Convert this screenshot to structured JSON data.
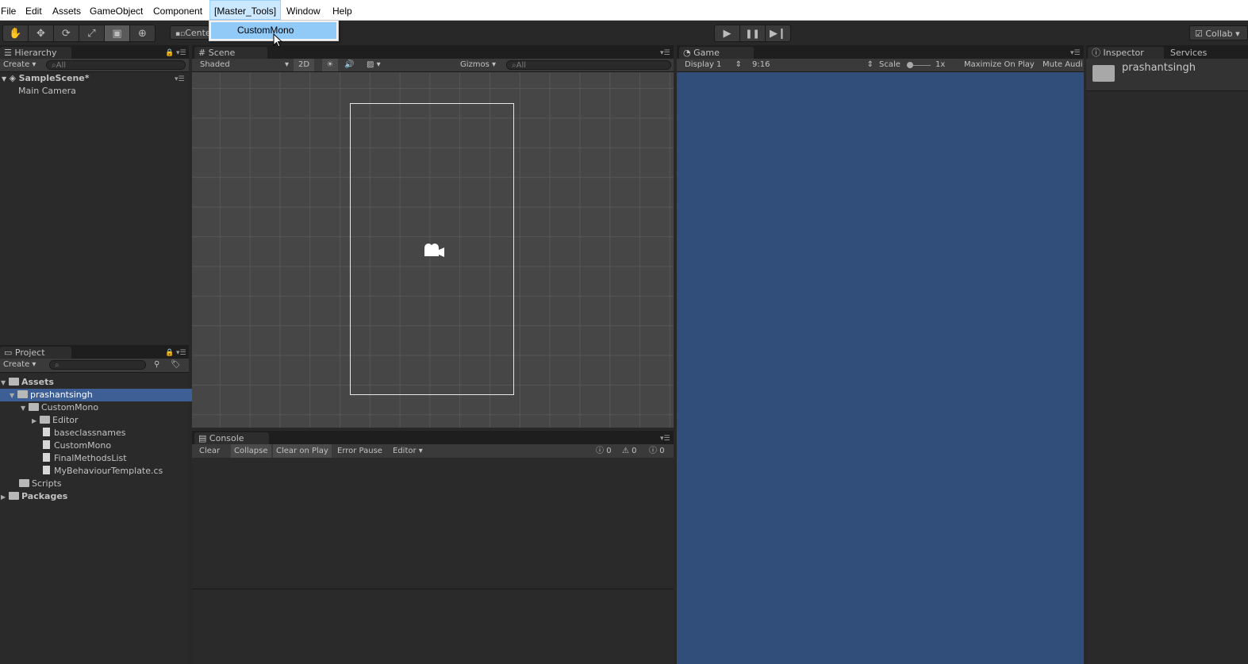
{
  "menubar": {
    "items": [
      "File",
      "Edit",
      "Assets",
      "GameObject",
      "Component",
      "[Master_Tools]",
      "Window",
      "Help"
    ],
    "dropdown_item": "CustomMono"
  },
  "toolbar": {
    "pivot_label": "Center",
    "collab_label": "Collab"
  },
  "hierarchy": {
    "tab": "Hierarchy",
    "create": "Create",
    "search_placeholder": "All",
    "scene_name": "SampleScene*",
    "items": [
      "Main Camera"
    ]
  },
  "project": {
    "tab": "Project",
    "create": "Create",
    "rows": [
      {
        "label": "Assets",
        "bold": true
      },
      {
        "label": "prashantsingh",
        "selected": true
      },
      {
        "label": "CustomMono"
      },
      {
        "label": "Editor"
      },
      {
        "label": "baseclassnames"
      },
      {
        "label": "CustomMono"
      },
      {
        "label": "FinalMethodsList"
      },
      {
        "label": "MyBehaviourTemplate.cs"
      },
      {
        "label": "Scripts"
      },
      {
        "label": "Packages",
        "bold": true
      }
    ]
  },
  "scene": {
    "tab": "Scene",
    "shading": "Shaded",
    "mode_2d": "2D",
    "gizmos": "Gizmos",
    "search_placeholder": "All"
  },
  "console": {
    "tab": "Console",
    "buttons": [
      "Clear",
      "Collapse",
      "Clear on Play",
      "Error Pause",
      "Editor"
    ],
    "log_count": "0",
    "warning_count": "0",
    "error_count": "0"
  },
  "game": {
    "tab": "Game",
    "display": "Display 1",
    "aspect": "9:16",
    "scale_label": "Scale",
    "scale_value": "1x",
    "maximize": "Maximize On Play",
    "mute": "Mute Audi",
    "background_color": "#314d79"
  },
  "inspector": {
    "tab": "Inspector",
    "services_tab": "Services",
    "object_name": "prashantsingh"
  }
}
